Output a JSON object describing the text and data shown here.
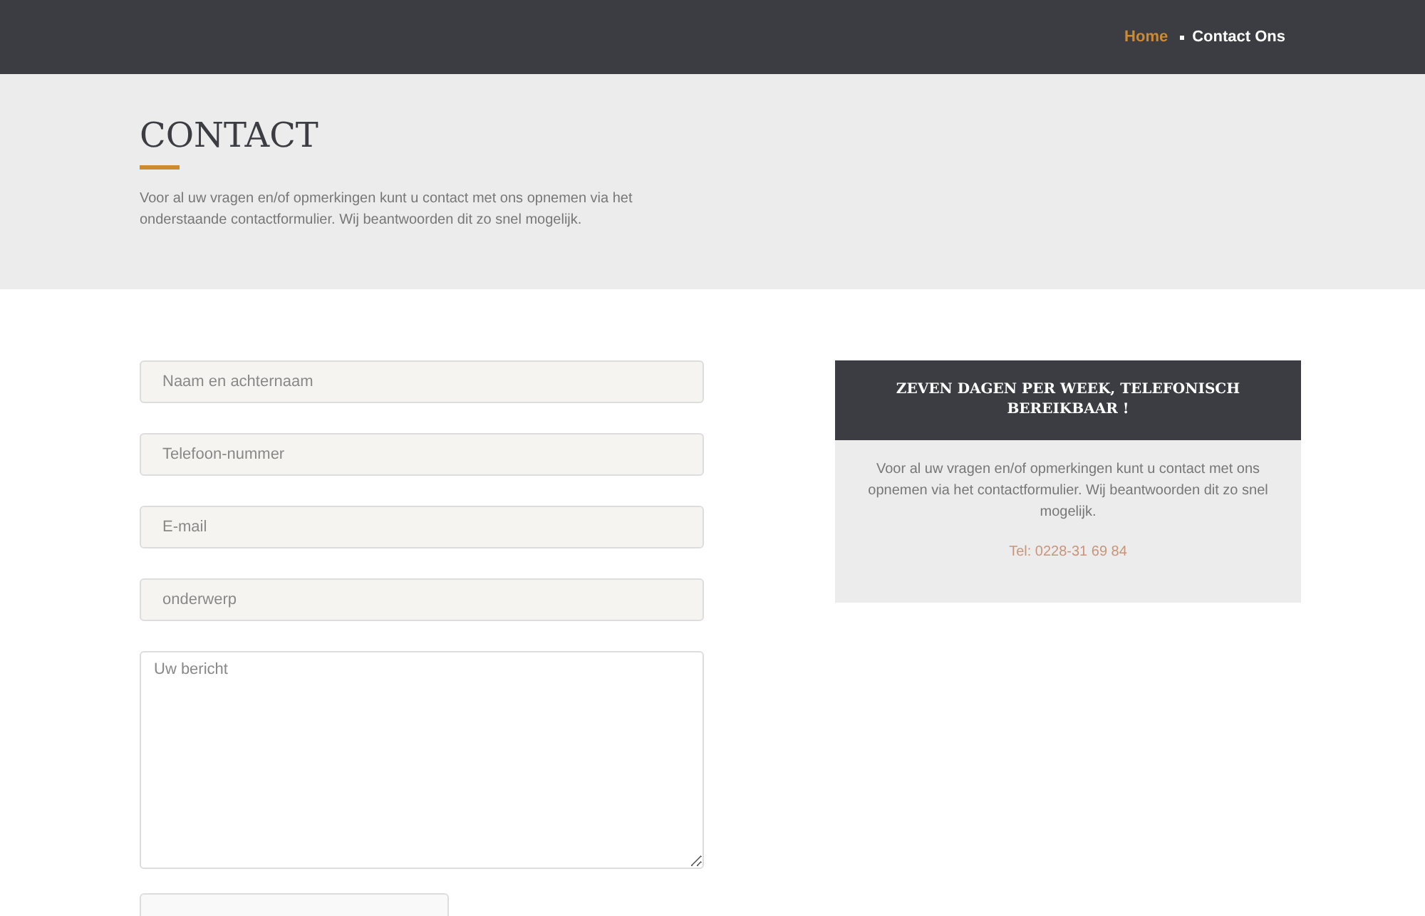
{
  "breadcrumb": [
    {
      "label": "Home",
      "selected": false
    },
    {
      "label": "Contact Ons",
      "selected": true
    }
  ],
  "page_header": {
    "title": "CONTACT",
    "intro": "Voor al uw vragen en/of opmerkingen kunt u contact met ons opnemen via het onderstaande contactformulier. Wij beantwoorden dit zo snel mogelijk."
  },
  "form": {
    "fields": [
      {
        "kind": "input",
        "placeholder": "Naam en achternaam"
      },
      {
        "kind": "input",
        "placeholder": "Telefoon-nummer"
      },
      {
        "kind": "input",
        "placeholder": "E-mail"
      },
      {
        "kind": "input",
        "placeholder": "onderwerp"
      },
      {
        "kind": "textarea",
        "placeholder": "Uw bericht"
      }
    ]
  },
  "info_card": {
    "title": "ZEVEN DAGEN PER WEEK, TELEFONISCH BEREIKBAAR !",
    "text": "Voor al uw vragen en/of opmerkingen kunt u contact met ons opnemen via het contactformulier. Wij beantwoorden dit zo snel mogelijk.",
    "phone": "Tel: 0228-31 69 84"
  }
}
